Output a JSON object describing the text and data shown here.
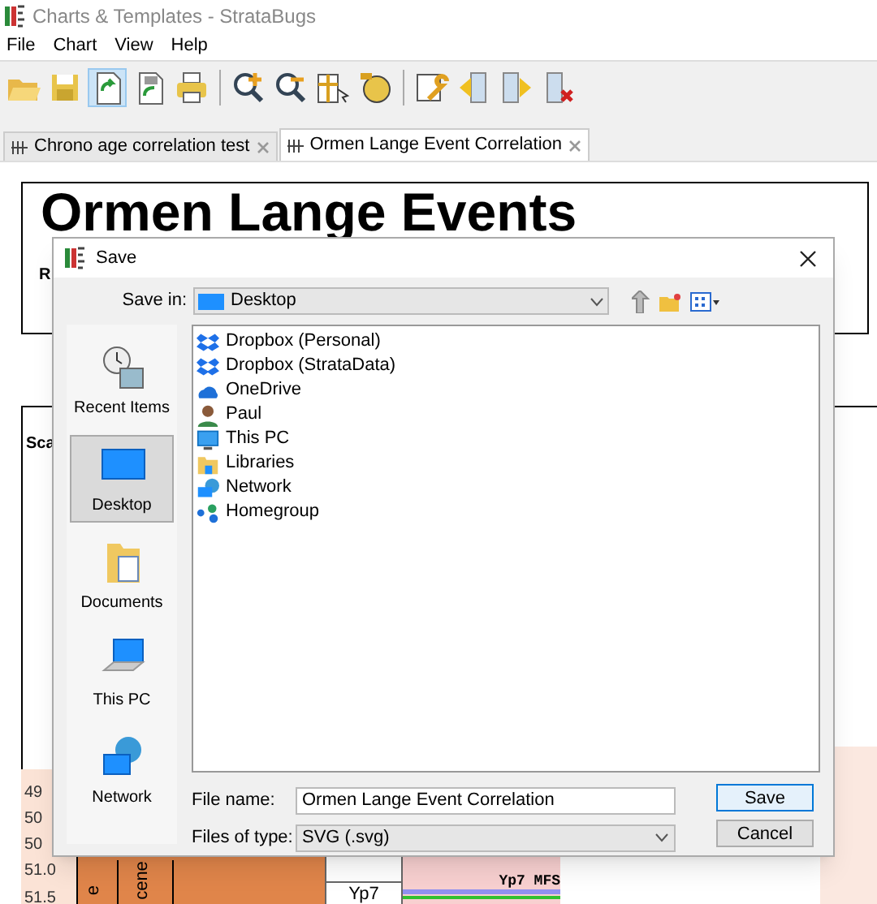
{
  "window": {
    "title": "Charts & Templates - StrataBugs"
  },
  "menu": [
    "File",
    "Chart",
    "View",
    "Help"
  ],
  "toolbar": [
    {
      "kind": "open",
      "selected": false
    },
    {
      "kind": "save",
      "selected": false
    },
    {
      "kind": "export",
      "selected": true
    },
    {
      "kind": "export_image",
      "selected": false
    },
    {
      "kind": "print",
      "selected": false
    },
    {
      "kind": "zoom_in",
      "selected": false
    },
    {
      "kind": "zoom_out",
      "selected": false
    },
    {
      "kind": "ruler",
      "selected": false
    },
    {
      "kind": "badge",
      "selected": false
    },
    {
      "kind": "wrench",
      "selected": false
    },
    {
      "kind": "move_left",
      "selected": false
    },
    {
      "kind": "move_right",
      "selected": false
    },
    {
      "kind": "delete_column",
      "selected": false
    }
  ],
  "tabs": [
    {
      "label": "Chrono age correlation test",
      "selected": false
    },
    {
      "label": "Ormen Lange Event Correlation",
      "selected": true
    }
  ],
  "chart": {
    "title": "Ormen Lange Events",
    "subtitle": "R",
    "scale_header": "Sca",
    "ages": [
      "49",
      "50",
      "50",
      "51.0",
      "51.5"
    ],
    "epoch_labels": [
      "e",
      "cene"
    ],
    "zone": "Yp7",
    "events": [
      "Yp7 MFS"
    ]
  },
  "dialog": {
    "title": "Save",
    "save_in_label": "Save in:",
    "save_in": "Desktop",
    "places": [
      {
        "label": "Recent Items",
        "kind": "recent",
        "selected": false
      },
      {
        "label": "Desktop",
        "kind": "desktop",
        "selected": true
      },
      {
        "label": "Documents",
        "kind": "documents",
        "selected": false
      },
      {
        "label": "This PC",
        "kind": "pc",
        "selected": false
      },
      {
        "label": "Network",
        "kind": "network",
        "selected": false
      }
    ],
    "files": [
      {
        "name": "Dropbox (Personal)",
        "kind": "dropbox"
      },
      {
        "name": "Dropbox (StrataData)",
        "kind": "dropbox"
      },
      {
        "name": "OneDrive",
        "kind": "cloud"
      },
      {
        "name": "Paul",
        "kind": "user"
      },
      {
        "name": "This PC",
        "kind": "pc"
      },
      {
        "name": "Libraries",
        "kind": "libraries"
      },
      {
        "name": "Network",
        "kind": "network"
      },
      {
        "name": "Homegroup",
        "kind": "homegroup"
      }
    ],
    "file_name_label": "File name:",
    "file_name": "Ormen Lange Event Correlation",
    "file_type_label": "Files of type:",
    "file_type": "SVG (.svg)",
    "buttons": [
      {
        "label": "Save",
        "kind": "default"
      },
      {
        "label": "Cancel",
        "kind": "normal"
      }
    ]
  }
}
